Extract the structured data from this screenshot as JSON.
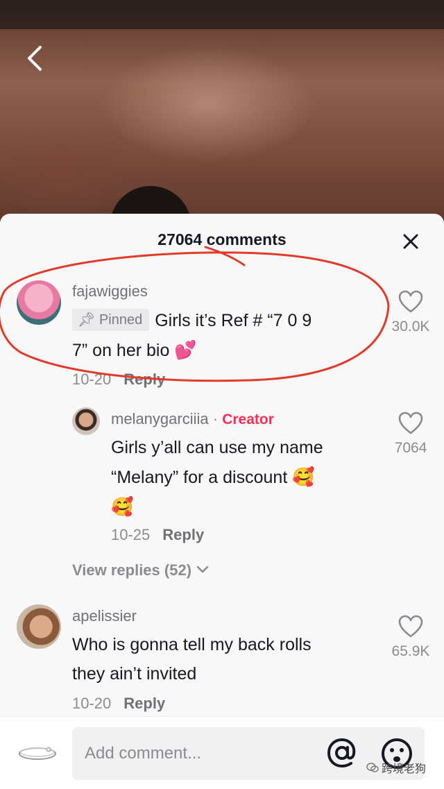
{
  "header": {
    "comment_count": "27064 comments",
    "back_icon": "chevron-left-icon",
    "close_icon": "close-icon"
  },
  "comments": [
    {
      "username": "fajawiggies",
      "pinned_label": "Pinned",
      "text_line1": "Girls it’s Ref # “7 0 9",
      "text_line2": "7” on her bio",
      "emoji": "💕",
      "date": "10-20",
      "reply_label": "Reply",
      "likes": "30.0K"
    },
    {
      "username": "melanygarciiia",
      "separator": "·",
      "badge": "Creator",
      "text_line1": "Girls y’all can use my name",
      "text_line2": "“Melany” for a discount",
      "emoji": "🥰",
      "date": "10-25",
      "reply_label": "Reply",
      "likes": "7064"
    },
    {
      "username": "apelissier",
      "text_line1": "Who is gonna tell my back rolls",
      "text_line2": "they ain’t invited",
      "date": "10-20",
      "reply_label": "Reply",
      "likes": "65.9K"
    }
  ],
  "view_replies": "View replies (52)",
  "composer": {
    "placeholder": "Add comment...",
    "at_icon": "at-sign-icon",
    "emoji_icon": "emoji-icon"
  },
  "watermark": "跨境老狗",
  "colors": {
    "creator": "#fe2c55",
    "annotation": "#e23a2a"
  }
}
